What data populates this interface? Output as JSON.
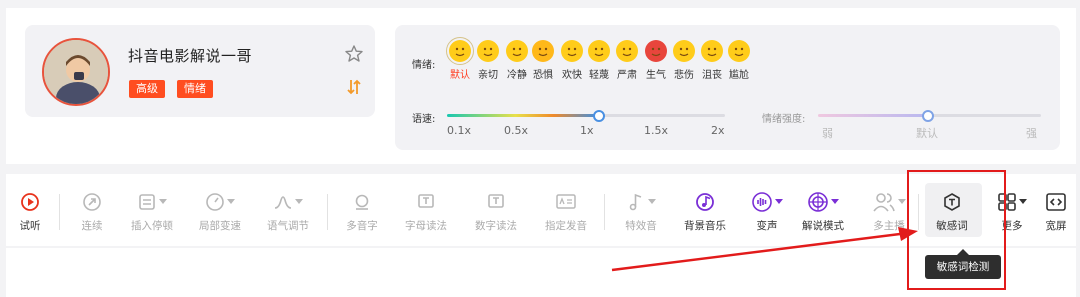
{
  "voice": {
    "name": "抖音电影解说一哥",
    "tags": [
      "高级",
      "情绪"
    ]
  },
  "emotion": {
    "label": "情绪:",
    "items": [
      {
        "name": "默认",
        "color": "#ffcc1a",
        "selected": true
      },
      {
        "name": "亲切",
        "color": "#ffcc1a"
      },
      {
        "name": "冷静",
        "color": "#ffcc1a"
      },
      {
        "name": "恐惧",
        "color": "#ffb81a"
      },
      {
        "name": "欢快",
        "color": "#ffcc1a"
      },
      {
        "name": "轻蔑",
        "color": "#ffcc1a"
      },
      {
        "name": "严肃",
        "color": "#ffcc1a"
      },
      {
        "name": "生气",
        "color": "#e8453c"
      },
      {
        "name": "悲伤",
        "color": "#ffcc1a"
      },
      {
        "name": "沮丧",
        "color": "#ffcc1a"
      },
      {
        "name": "尴尬",
        "color": "#ffcc1a"
      }
    ]
  },
  "speed": {
    "label": "语速:",
    "ticks": [
      "0.1x",
      "0.5x",
      "1x",
      "1.5x",
      "2x"
    ],
    "value": "1x"
  },
  "intensity": {
    "label": "情绪强度:",
    "ticks": [
      "弱",
      "默认",
      "强"
    ],
    "value": "默认"
  },
  "toolbar": {
    "items": [
      {
        "label": "试听",
        "icon": "play-icon",
        "enabled": true,
        "accent": "#e8331c"
      },
      {
        "label": "连续",
        "icon": "continuous-icon",
        "enabled": false
      },
      {
        "label": "插入停顿",
        "icon": "pause-insert-icon",
        "enabled": false,
        "dropdown": true
      },
      {
        "label": "局部变速",
        "icon": "speed-gauge-icon",
        "enabled": false,
        "dropdown": true
      },
      {
        "label": "语气调节",
        "icon": "tone-wave-icon",
        "enabled": false,
        "dropdown": true
      },
      {
        "label": "多音字",
        "icon": "polyphone-icon",
        "enabled": false
      },
      {
        "label": "字母读法",
        "icon": "letter-read-icon",
        "enabled": false
      },
      {
        "label": "数字读法",
        "icon": "number-read-icon",
        "enabled": false
      },
      {
        "label": "指定发音",
        "icon": "pronunciation-icon",
        "enabled": false
      },
      {
        "label": "特效音",
        "icon": "sound-effect-icon",
        "enabled": false,
        "dropdown": true
      },
      {
        "label": "背景音乐",
        "icon": "background-music-icon",
        "enabled": true,
        "accent": "#7a2fd6"
      },
      {
        "label": "变声",
        "icon": "voice-change-icon",
        "enabled": true,
        "accent": "#7a2fd6",
        "dropdown": true
      },
      {
        "label": "解说模式",
        "icon": "narration-mode-icon",
        "enabled": true,
        "accent": "#7a2fd6",
        "dropdown": true
      },
      {
        "label": "多主播",
        "icon": "multi-anchor-icon",
        "enabled": false,
        "dropdown": true
      },
      {
        "label": "敏感词",
        "icon": "sensitive-word-icon",
        "enabled": true
      },
      {
        "label": "更多",
        "icon": "more-grid-icon",
        "enabled": true,
        "dropdown": true
      },
      {
        "label": "宽屏",
        "icon": "widescreen-icon",
        "enabled": true
      }
    ]
  },
  "tooltip": {
    "text": "敏感词检测"
  },
  "colors": {
    "accent_red": "#ff4d20",
    "purple": "#7a2fd6",
    "highlight": "#e21b1b"
  }
}
